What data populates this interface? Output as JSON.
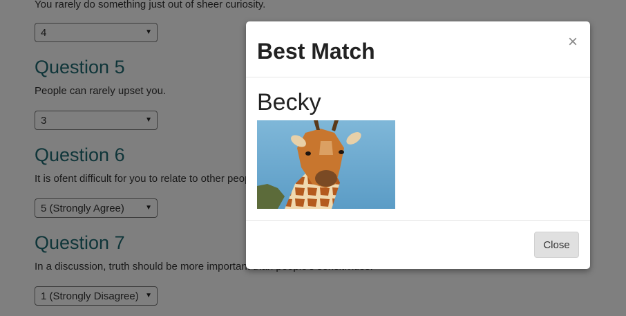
{
  "background": {
    "q4_text": "You rarely do something just out of sheer curiosity.",
    "q4_select": "4",
    "questions": [
      {
        "title": "Question 5",
        "text": "People can rarely upset you.",
        "select": "3"
      },
      {
        "title": "Question 6",
        "text": "It is ofent difficult for you to relate to other people's feelings.",
        "select": "5 (Strongly Agree)"
      },
      {
        "title": "Question 7",
        "text": "In a discussion, truth should be more important than people's sensitivities.",
        "select": "1 (Strongly Disagree)"
      }
    ]
  },
  "modal": {
    "title": "Best Match",
    "close_icon": "×",
    "match_name": "Becky",
    "image_alt": "giraffe",
    "close_label": "Close"
  },
  "colors": {
    "question_title": "#1f6b73",
    "backdrop": "rgba(0,0,0,0.5)"
  }
}
